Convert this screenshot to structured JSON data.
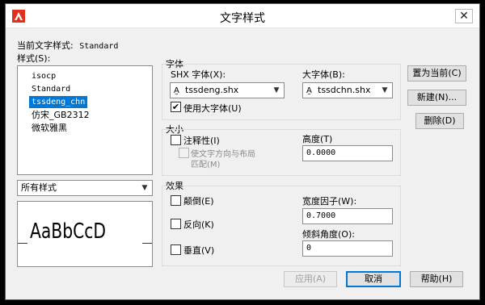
{
  "window": {
    "title": "文字样式",
    "close_glyph": "✕"
  },
  "current_style": {
    "label": "当前文字样式:",
    "value": "Standard"
  },
  "styles": {
    "label": "样式(S):",
    "items": [
      "isocp",
      "Standard",
      "tssdeng_chn",
      "仿宋_GB2312",
      "微软雅黑"
    ],
    "selected_index": 2,
    "filter_value": "所有样式"
  },
  "preview": {
    "text": "AaBbCcD",
    "baseline_color": "#c00000"
  },
  "font": {
    "group_label": "字体",
    "shx_label": "SHX 字体(X):",
    "shx_value": "tssdeng.shx",
    "bigfont_label": "大字体(B):",
    "bigfont_value": "tssdchn.shx",
    "use_bigfont_label": "使用大字体(U)",
    "use_bigfont_checked": true
  },
  "size": {
    "group_label": "大小",
    "annotative_label": "注释性(I)",
    "annotative_checked": false,
    "match_layout_line1": "使文字方向与布局",
    "match_layout_line2": "匹配(M)",
    "height_label": "高度(T)",
    "height_value": "0.0000"
  },
  "effects": {
    "group_label": "效果",
    "upside_down_label": "颠倒(E)",
    "backwards_label": "反向(K)",
    "vertical_label": "垂直(V)",
    "width_factor_label": "宽度因子(W):",
    "width_factor_value": "0.7000",
    "oblique_label": "倾斜角度(O):",
    "oblique_value": "0"
  },
  "buttons": {
    "set_current": "置为当前(C)",
    "new": "新建(N)...",
    "delete": "删除(D)",
    "apply": "应用(A)",
    "cancel": "取消",
    "help": "帮助(H)"
  },
  "colors": {
    "selection": "#0078d7",
    "app_icon": "#e0301e",
    "default_button_border": "#0078d7"
  }
}
